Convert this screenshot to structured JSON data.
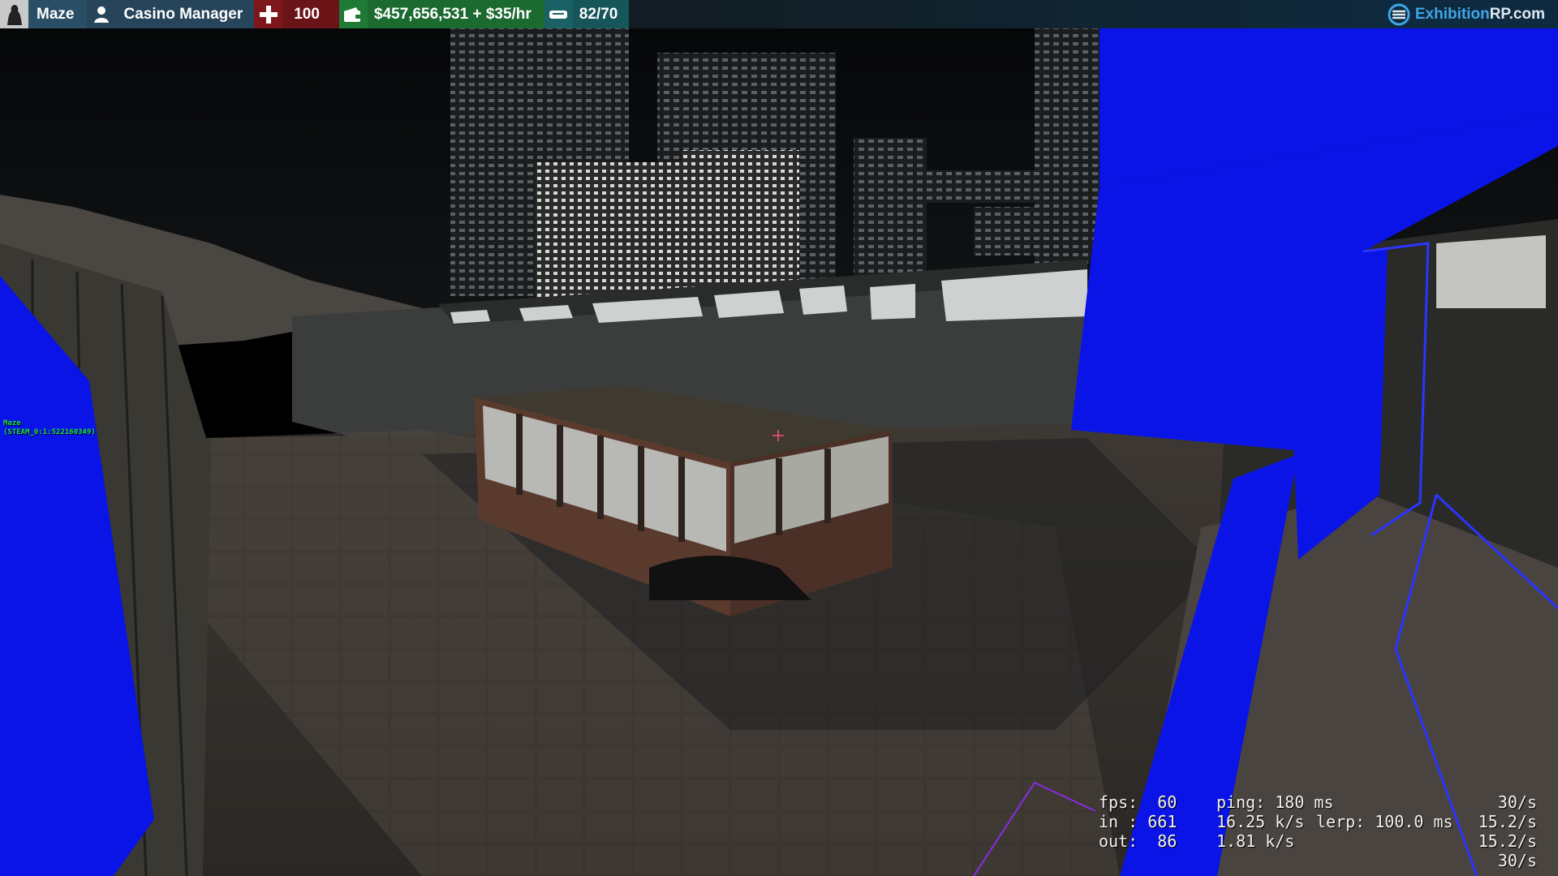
{
  "hud": {
    "player_name": "Maze",
    "job": "Casino Manager",
    "health": "100",
    "money": "$457,656,531 + $35/hr",
    "armor": "82/70",
    "brand_prefix": "Exhibition",
    "brand_suffix": "RP.com"
  },
  "nametag": {
    "name": "Maze",
    "steam_id": "(STEAM_0:1:522160349)"
  },
  "netgraph": {
    "fps_label": "fps:  60",
    "ping_label": "ping: 180 ms",
    "in_label": "in : 661",
    "in_rate": "16.25 k/s",
    "lerp_label": "lerp: 100.0 ms",
    "out_label": "out:  86",
    "out_rate": "1.81 k/s",
    "rate_1": "30/s",
    "rate_2": "15.2/s",
    "rate_3": "15.2/s",
    "rate_4": "30/s"
  },
  "colors": {
    "name_green": "#19e052",
    "health_red": "#6a1417",
    "money_green": "#1b6a2f",
    "armor_teal": "#165559",
    "brand_blue": "#3fa6e6",
    "missing_texture_blue": "#0a14e6"
  }
}
